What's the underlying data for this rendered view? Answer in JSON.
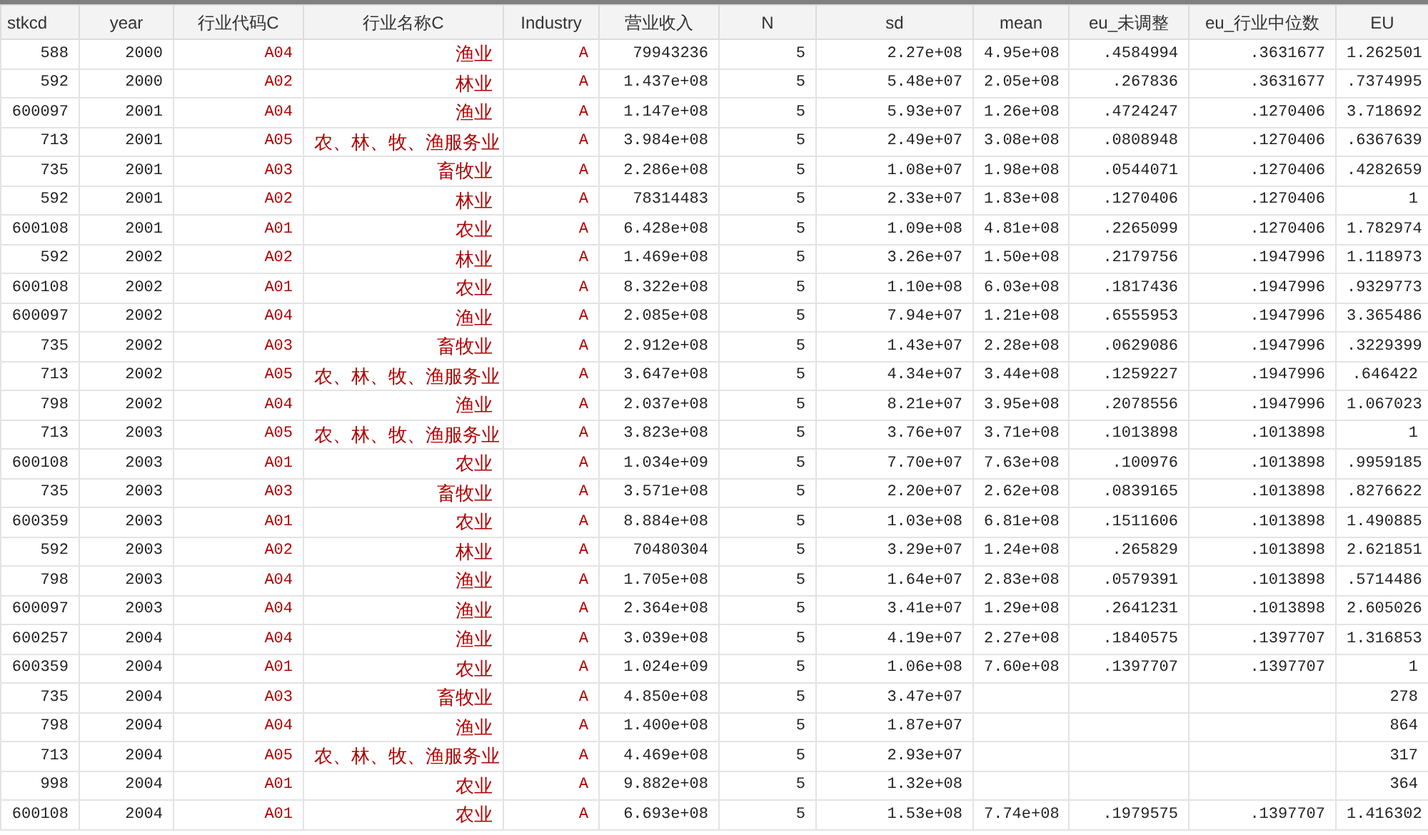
{
  "table": {
    "columns": [
      {
        "label": "stkcd",
        "kind": "number"
      },
      {
        "label": "year",
        "kind": "number"
      },
      {
        "label": "行业代码C",
        "kind": "string"
      },
      {
        "label": "行业名称C",
        "kind": "string"
      },
      {
        "label": "Industry",
        "kind": "string"
      },
      {
        "label": "营业收入",
        "kind": "number"
      },
      {
        "label": "N",
        "kind": "number"
      },
      {
        "label": "sd",
        "kind": "number"
      },
      {
        "label": "mean",
        "kind": "number"
      },
      {
        "label": "eu_未调整",
        "kind": "number"
      },
      {
        "label": "eu_行业中位数",
        "kind": "number"
      },
      {
        "label": "EU",
        "kind": "number"
      }
    ],
    "rows": [
      [
        "588",
        "2000",
        "A04",
        "渔业",
        "A",
        "79943236",
        "5",
        "2.27e+08",
        "4.95e+08",
        ".4584994",
        ".3631677",
        "1.262501"
      ],
      [
        "592",
        "2000",
        "A02",
        "林业",
        "A",
        "1.437e+08",
        "5",
        "5.48e+07",
        "2.05e+08",
        ".267836",
        ".3631677",
        ".7374995"
      ],
      [
        "600097",
        "2001",
        "A04",
        "渔业",
        "A",
        "1.147e+08",
        "5",
        "5.93e+07",
        "1.26e+08",
        ".4724247",
        ".1270406",
        "3.718692"
      ],
      [
        "713",
        "2001",
        "A05",
        "农、林、牧、渔服务业",
        "A",
        "3.984e+08",
        "5",
        "2.49e+07",
        "3.08e+08",
        ".0808948",
        ".1270406",
        ".6367639"
      ],
      [
        "735",
        "2001",
        "A03",
        "畜牧业",
        "A",
        "2.286e+08",
        "5",
        "1.08e+07",
        "1.98e+08",
        ".0544071",
        ".1270406",
        ".4282659"
      ],
      [
        "592",
        "2001",
        "A02",
        "林业",
        "A",
        "78314483",
        "5",
        "2.33e+07",
        "1.83e+08",
        ".1270406",
        ".1270406",
        "1"
      ],
      [
        "600108",
        "2001",
        "A01",
        "农业",
        "A",
        "6.428e+08",
        "5",
        "1.09e+08",
        "4.81e+08",
        ".2265099",
        ".1270406",
        "1.782974"
      ],
      [
        "592",
        "2002",
        "A02",
        "林业",
        "A",
        "1.469e+08",
        "5",
        "3.26e+07",
        "1.50e+08",
        ".2179756",
        ".1947996",
        "1.118973"
      ],
      [
        "600108",
        "2002",
        "A01",
        "农业",
        "A",
        "8.322e+08",
        "5",
        "1.10e+08",
        "6.03e+08",
        ".1817436",
        ".1947996",
        ".9329773"
      ],
      [
        "600097",
        "2002",
        "A04",
        "渔业",
        "A",
        "2.085e+08",
        "5",
        "7.94e+07",
        "1.21e+08",
        ".6555953",
        ".1947996",
        "3.365486"
      ],
      [
        "735",
        "2002",
        "A03",
        "畜牧业",
        "A",
        "2.912e+08",
        "5",
        "1.43e+07",
        "2.28e+08",
        ".0629086",
        ".1947996",
        ".3229399"
      ],
      [
        "713",
        "2002",
        "A05",
        "农、林、牧、渔服务业",
        "A",
        "3.647e+08",
        "5",
        "4.34e+07",
        "3.44e+08",
        ".1259227",
        ".1947996",
        ".646422"
      ],
      [
        "798",
        "2002",
        "A04",
        "渔业",
        "A",
        "2.037e+08",
        "5",
        "8.21e+07",
        "3.95e+08",
        ".2078556",
        ".1947996",
        "1.067023"
      ],
      [
        "713",
        "2003",
        "A05",
        "农、林、牧、渔服务业",
        "A",
        "3.823e+08",
        "5",
        "3.76e+07",
        "3.71e+08",
        ".1013898",
        ".1013898",
        "1"
      ],
      [
        "600108",
        "2003",
        "A01",
        "农业",
        "A",
        "1.034e+09",
        "5",
        "7.70e+07",
        "7.63e+08",
        ".100976",
        ".1013898",
        ".9959185"
      ],
      [
        "735",
        "2003",
        "A03",
        "畜牧业",
        "A",
        "3.571e+08",
        "5",
        "2.20e+07",
        "2.62e+08",
        ".0839165",
        ".1013898",
        ".8276622"
      ],
      [
        "600359",
        "2003",
        "A01",
        "农业",
        "A",
        "8.884e+08",
        "5",
        "1.03e+08",
        "6.81e+08",
        ".1511606",
        ".1013898",
        "1.490885"
      ],
      [
        "592",
        "2003",
        "A02",
        "林业",
        "A",
        "70480304",
        "5",
        "3.29e+07",
        "1.24e+08",
        ".265829",
        ".1013898",
        "2.621851"
      ],
      [
        "798",
        "2003",
        "A04",
        "渔业",
        "A",
        "1.705e+08",
        "5",
        "1.64e+07",
        "2.83e+08",
        ".0579391",
        ".1013898",
        ".5714486"
      ],
      [
        "600097",
        "2003",
        "A04",
        "渔业",
        "A",
        "2.364e+08",
        "5",
        "3.41e+07",
        "1.29e+08",
        ".2641231",
        ".1013898",
        "2.605026"
      ],
      [
        "600257",
        "2004",
        "A04",
        "渔业",
        "A",
        "3.039e+08",
        "5",
        "4.19e+07",
        "2.27e+08",
        ".1840575",
        ".1397707",
        "1.316853"
      ],
      [
        "600359",
        "2004",
        "A01",
        "农业",
        "A",
        "1.024e+09",
        "5",
        "1.06e+08",
        "7.60e+08",
        ".1397707",
        ".1397707",
        "1"
      ],
      [
        "735",
        "2004",
        "A03",
        "畜牧业",
        "A",
        "4.850e+08",
        "5",
        "3.47e+07",
        null,
        null,
        null,
        "278"
      ],
      [
        "798",
        "2004",
        "A04",
        "渔业",
        "A",
        "1.400e+08",
        "5",
        "1.87e+07",
        null,
        null,
        null,
        "864"
      ],
      [
        "713",
        "2004",
        "A05",
        "农、林、牧、渔服务业",
        "A",
        "4.469e+08",
        "5",
        "2.93e+07",
        null,
        null,
        null,
        "317"
      ],
      [
        "998",
        "2004",
        "A01",
        "农业",
        "A",
        "9.882e+08",
        "5",
        "1.32e+08",
        null,
        null,
        null,
        "364"
      ],
      [
        "600108",
        "2004",
        "A01",
        "农业",
        "A",
        "6.693e+08",
        "5",
        "1.53e+08",
        "7.74e+08",
        ".1979575",
        ".1397707",
        "1.416302"
      ]
    ]
  }
}
